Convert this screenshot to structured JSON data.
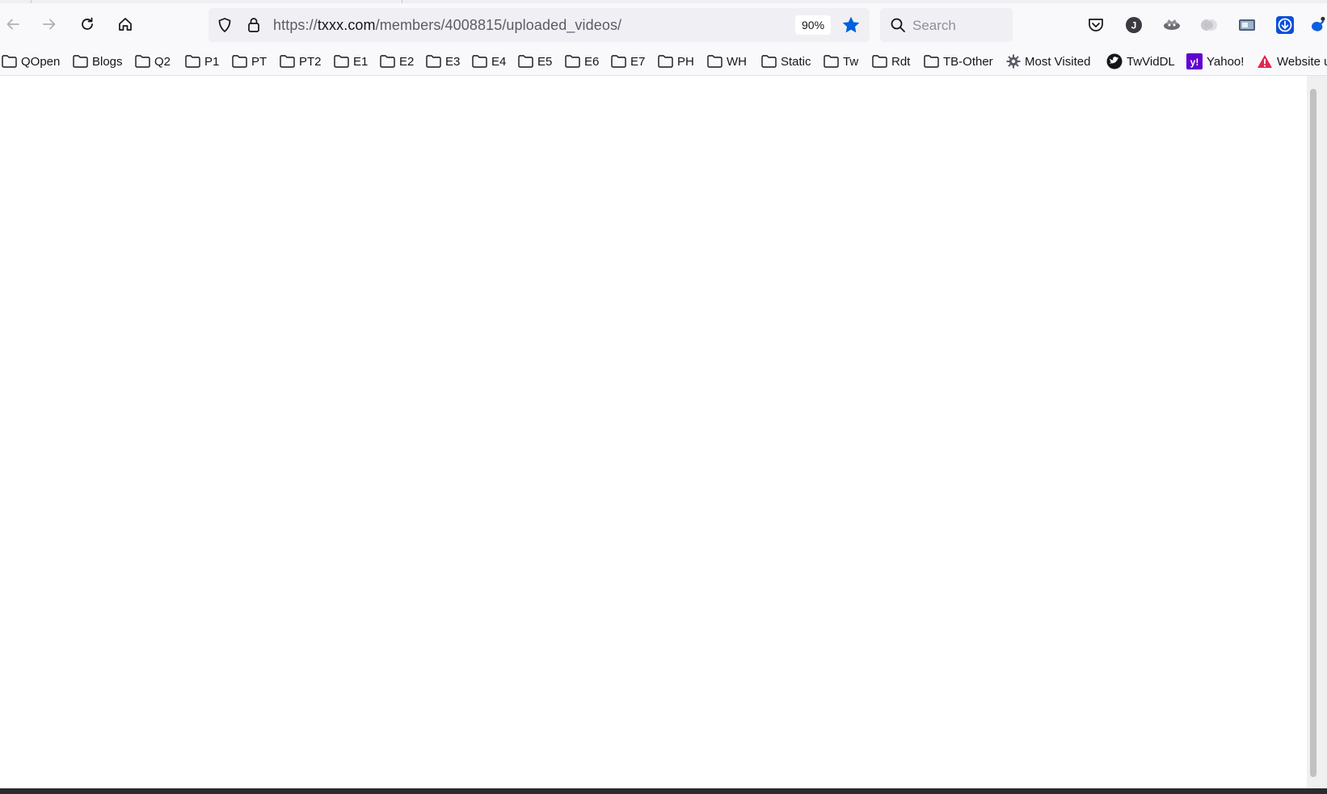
{
  "toolbar": {
    "url_scheme": "https://",
    "url_host": "txxx.com",
    "url_path": "/members/4008815/uploaded_videos/",
    "zoom": "90%",
    "search_placeholder": "Search"
  },
  "extensions": [
    {
      "icon": "pocket-icon"
    },
    {
      "icon": "account-avatar-icon",
      "letter": "J"
    },
    {
      "icon": "extension-icon"
    },
    {
      "icon": "extension-icon"
    },
    {
      "icon": "extension-icon"
    },
    {
      "icon": "download-icon"
    }
  ],
  "bookmarks": [
    {
      "label": "QOpen",
      "icon": "folder-icon"
    },
    {
      "label": "Blogs",
      "icon": "folder-icon"
    },
    {
      "label": "Q2",
      "icon": "folder-icon"
    },
    {
      "label": "P1",
      "icon": "folder-icon"
    },
    {
      "label": "PT",
      "icon": "folder-icon"
    },
    {
      "label": "PT2",
      "icon": "folder-icon"
    },
    {
      "label": "E1",
      "icon": "folder-icon"
    },
    {
      "label": "E2",
      "icon": "folder-icon"
    },
    {
      "label": "E3",
      "icon": "folder-icon"
    },
    {
      "label": "E4",
      "icon": "folder-icon"
    },
    {
      "label": "E5",
      "icon": "folder-icon"
    },
    {
      "label": "E6",
      "icon": "folder-icon"
    },
    {
      "label": "E7",
      "icon": "folder-icon"
    },
    {
      "label": "PH",
      "icon": "folder-icon"
    },
    {
      "label": "WH",
      "icon": "folder-icon"
    },
    {
      "label": "Static",
      "icon": "folder-icon"
    },
    {
      "label": "Tw",
      "icon": "folder-icon"
    },
    {
      "label": "Rdt",
      "icon": "folder-icon"
    },
    {
      "label": "TB-Other",
      "icon": "folder-icon"
    },
    {
      "label": "Most Visited",
      "icon": "gear-icon"
    },
    {
      "label": "TwVidDL",
      "icon": "twviddl-icon"
    },
    {
      "label": "Yahoo!",
      "icon": "yahoo-icon"
    },
    {
      "label": "Website u",
      "icon": "warning-icon"
    }
  ],
  "colors": {
    "accent": "#0061e0",
    "toolbar_bg": "#f9f9fb",
    "field_bg": "#f0f0f4",
    "yahoo": "#6001d2",
    "warning": "#e22850"
  }
}
